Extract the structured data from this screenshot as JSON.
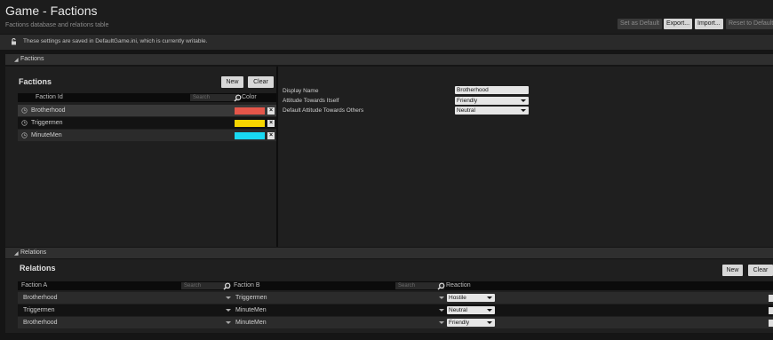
{
  "header": {
    "title": "Game - Factions",
    "subtitle": "Factions database and relations table",
    "buttons": {
      "set_default": "Set as Default",
      "export": "Export...",
      "import": "Import...",
      "reset": "Reset to Defaults"
    }
  },
  "notice": {
    "icon": "lock-icon",
    "text": "These settings are saved in DefaultGame.ini, which is currently writable."
  },
  "factions_section": {
    "bar_label": "Factions",
    "panel_title": "Factions",
    "new_label": "New",
    "clear_label": "Clear",
    "columns": {
      "id": "Faction Id",
      "search_placeholder": "Search",
      "color": "Color"
    },
    "rows": [
      {
        "name": "Brotherhood",
        "color": "#e4564a"
      },
      {
        "name": "Triggermen",
        "color": "#f7d500"
      },
      {
        "name": "MinuteMen",
        "color": "#19d9f2"
      }
    ]
  },
  "details": {
    "display_name_label": "Display Name",
    "display_name_value": "Brotherhood",
    "attitude_self_label": "Attitude Towards Itself",
    "attitude_self_value": "Friendly",
    "attitude_others_label": "Default Attitude Towards Others",
    "attitude_others_value": "Neutral"
  },
  "relations_section": {
    "bar_label": "Relations",
    "panel_title": "Relations",
    "new_label": "New",
    "clear_label": "Clear",
    "columns": {
      "a": "Faction A",
      "b": "Faction B",
      "reaction": "Reaction",
      "search_placeholder": "Search"
    },
    "rows": [
      {
        "a": "Brotherhood",
        "b": "Triggermen",
        "reaction": "Hostile"
      },
      {
        "a": "Triggermen",
        "b": "MinuteMen",
        "reaction": "Neutral"
      },
      {
        "a": "Brotherhood",
        "b": "MinuteMen",
        "reaction": "Friendly"
      }
    ]
  }
}
